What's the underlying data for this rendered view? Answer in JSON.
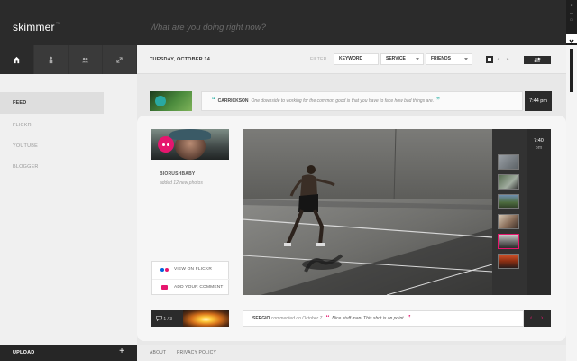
{
  "app": {
    "logo": "skimmer",
    "logo_tm": "™"
  },
  "header": {
    "status_placeholder": "What are you doing right now?"
  },
  "nav_tabs": [
    {
      "icon": "home-icon",
      "active": true
    },
    {
      "icon": "person-icon",
      "active": false
    },
    {
      "icon": "people-icon",
      "active": false
    },
    {
      "icon": "expand-icon",
      "active": false
    }
  ],
  "filterbar": {
    "date": "TUESDAY, OCTOBER 14",
    "filter_label": "FILTER",
    "keyword": "KEYWORD",
    "service": "SERVICE",
    "friends": "FRIENDS",
    "page_prev": "«",
    "page_next": "»"
  },
  "sidebar": {
    "items": [
      {
        "label": "FEED",
        "active": true
      },
      {
        "label": "FLICKR",
        "active": false
      },
      {
        "label": "YOUTUBE",
        "active": false
      },
      {
        "label": "BLOGGER",
        "active": false
      }
    ],
    "upload_label": "UPLOAD",
    "upload_plus": "+"
  },
  "footer": {
    "about": "ABOUT",
    "privacy": "PRIVACY POLICY"
  },
  "feed_row": {
    "user": "CARRICKSON",
    "text": "One downside to working for the common good is that you have to face how bad things are.",
    "open_quote": "‘‘",
    "close_quote": "’’",
    "time": "7:44 pm"
  },
  "post": {
    "user": "BIORUSHBABY",
    "action": "added 12 new photos",
    "view_on": "VIEW ON FLICKR",
    "add_comment": "ADD YOUR COMMENT",
    "time_hour": "7:40",
    "time_ampm": "pm",
    "comment_count": "1 / 3",
    "comment_user": "SERGIO",
    "comment_meta": "commented on October 7",
    "comment_text": "Nice stuff man! This shot is on point.",
    "comment_open": "‘‘",
    "comment_close": "’’",
    "prev": "‹",
    "next": "›"
  },
  "colors": {
    "accent_pink": "#e6166e",
    "accent_teal": "#2fb1a6",
    "dark": "#2b2b2b"
  }
}
